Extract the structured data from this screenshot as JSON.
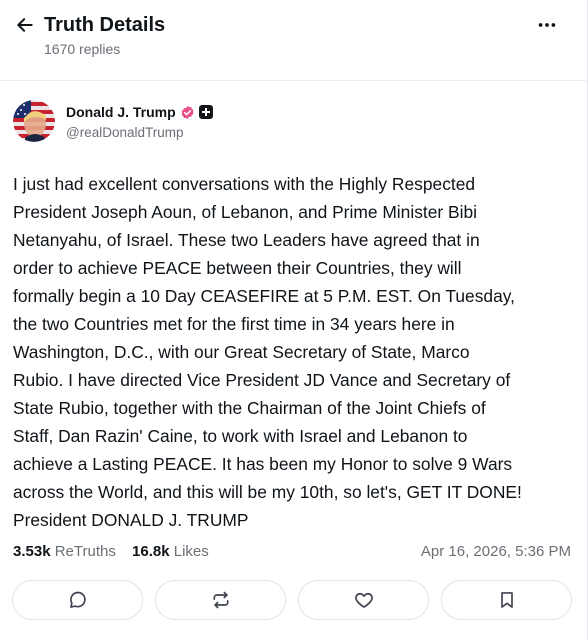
{
  "header": {
    "title": "Truth Details",
    "replies_count": "1670 replies",
    "back_icon": "arrow-left-icon",
    "more_icon": "more-horizontal-icon"
  },
  "author": {
    "name": "Donald J. Trump",
    "handle": "@realDonaldTrump",
    "verified_icon": "verified-badge-icon",
    "plus_icon": "plus-badge-icon",
    "verified_color": "#e8508a"
  },
  "post": {
    "text": "I just had excellent conversations with the Highly Respected\nPresident Joseph Aoun, of Lebanon, and Prime Minister Bibi\nNetanyahu, of Israel. These two Leaders have agreed that in\norder to achieve PEACE between their Countries, they will\nformally begin a 10 Day CEASEFIRE at 5 P.M. EST. On Tuesday,\nthe two Countries met for the first time in 34 years here in\nWashington, D.C., with our Great Secretary of State, Marco\nRubio. I have directed Vice President JD Vance and Secretary of\nState Rubio, together with the Chairman of the Joint Chiefs of\nStaff, Dan Razin' Caine, to work with Israel and Lebanon to\nachieve a Lasting PEACE. It has been my Honor to solve 9 Wars\nacross the World, and this will be my 10th, so let's, GET IT DONE!\nPresident DONALD J. TRUMP"
  },
  "stats": {
    "retruths_count": "3.53k",
    "retruths_label": "ReTruths",
    "likes_count": "16.8k",
    "likes_label": "Likes",
    "timestamp": "Apr 16, 2026, 5:36 PM"
  },
  "actions": [
    {
      "name": "reply",
      "icon": "reply-icon"
    },
    {
      "name": "retruth",
      "icon": "retruth-icon"
    },
    {
      "name": "like",
      "icon": "heart-icon"
    },
    {
      "name": "bookmark",
      "icon": "bookmark-icon"
    }
  ]
}
